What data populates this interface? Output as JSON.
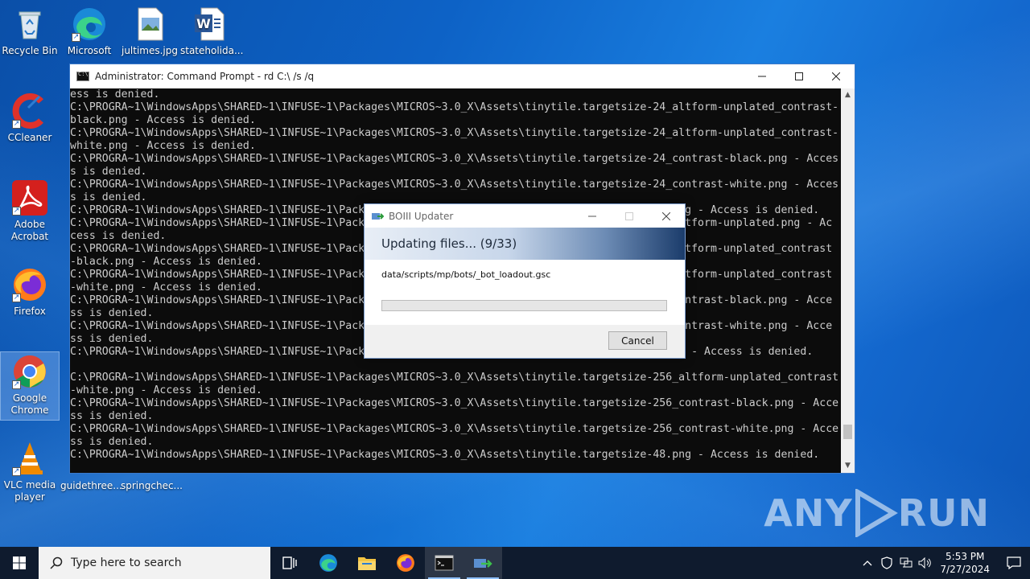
{
  "desktop": {
    "icons": [
      {
        "label": "Recycle Bin"
      },
      {
        "label": "Microsoft Edge"
      },
      {
        "label": "jultimes.jpg"
      },
      {
        "label": "stateholida..."
      },
      {
        "label": "CCleaner"
      },
      {
        "label": "Adobe Acrobat"
      },
      {
        "label": "Firefox"
      },
      {
        "label": "Google Chrome"
      },
      {
        "label": "VLC media player"
      },
      {
        "label": "guidethree..."
      },
      {
        "label": "springchec..."
      }
    ]
  },
  "cmd_window": {
    "title": "Administrator: Command Prompt - rd  C:\\ /s /q",
    "lines": [
      "ess is denied.",
      "C:\\PROGRA~1\\WindowsApps\\SHARED~1\\INFUSE~1\\Packages\\MICROS~3.0_X\\Assets\\tinytile.targetsize-24_altform-unplated_contrast-",
      "black.png - Access is denied.",
      "C:\\PROGRA~1\\WindowsApps\\SHARED~1\\INFUSE~1\\Packages\\MICROS~3.0_X\\Assets\\tinytile.targetsize-24_altform-unplated_contrast-",
      "white.png - Access is denied.",
      "C:\\PROGRA~1\\WindowsApps\\SHARED~1\\INFUSE~1\\Packages\\MICROS~3.0_X\\Assets\\tinytile.targetsize-24_contrast-black.png - Acces",
      "s is denied.",
      "C:\\PROGRA~1\\WindowsApps\\SHARED~1\\INFUSE~1\\Packages\\MICROS~3.0_X\\Assets\\tinytile.targetsize-24_contrast-white.png - Acces",
      "s is denied.",
      "C:\\PROGRA~1\\WindowsApps\\SHARED~1\\INFUSE~1\\Pack                                                 ng - Access is denied.",
      "C:\\PROGRA~1\\WindowsApps\\SHARED~1\\INFUSE~1\\Pack                                                 ltform-unplated.png - Ac",
      "cess is denied.",
      "C:\\PROGRA~1\\WindowsApps\\SHARED~1\\INFUSE~1\\Pack                                                 ltform-unplated_contrast",
      "-black.png - Access is denied.",
      "C:\\PROGRA~1\\WindowsApps\\SHARED~1\\INFUSE~1\\Pack                                                 ltform-unplated_contrast",
      "-white.png - Access is denied.",
      "C:\\PROGRA~1\\WindowsApps\\SHARED~1\\INFUSE~1\\Pack                                                 ontrast-black.png - Acce",
      "ss is denied.",
      "C:\\PROGRA~1\\WindowsApps\\SHARED~1\\INFUSE~1\\Pack                                                 ontrast-white.png - Acce",
      "ss is denied.",
      "C:\\PROGRA~1\\WindowsApps\\SHARED~1\\INFUSE~1\\Pack                                                 g - Access is denied.",
      "",
      "C:\\PROGRA~1\\WindowsApps\\SHARED~1\\INFUSE~1\\Packages\\MICROS~3.0_X\\Assets\\tinytile.targetsize-256_altform-unplated_contrast",
      "-white.png - Access is denied.",
      "C:\\PROGRA~1\\WindowsApps\\SHARED~1\\INFUSE~1\\Packages\\MICROS~3.0_X\\Assets\\tinytile.targetsize-256_contrast-black.png - Acce",
      "ss is denied.",
      "C:\\PROGRA~1\\WindowsApps\\SHARED~1\\INFUSE~1\\Packages\\MICROS~3.0_X\\Assets\\tinytile.targetsize-256_contrast-white.png - Acce",
      "ss is denied.",
      "C:\\PROGRA~1\\WindowsApps\\SHARED~1\\INFUSE~1\\Packages\\MICROS~3.0_X\\Assets\\tinytile.targetsize-48.png - Access is denied."
    ]
  },
  "updater": {
    "title": "BOIII Updater",
    "heading": "Updating files... (9/33)",
    "current_file": "data/scripts/mp/bots/_bot_loadout.gsc",
    "progress_fraction": 0.0,
    "cancel_label": "Cancel"
  },
  "taskbar": {
    "search_placeholder": "Type here to search",
    "time": "5:53 PM",
    "date": "7/27/2024"
  },
  "watermark": {
    "text_left": "ANY",
    "text_right": "RUN"
  }
}
